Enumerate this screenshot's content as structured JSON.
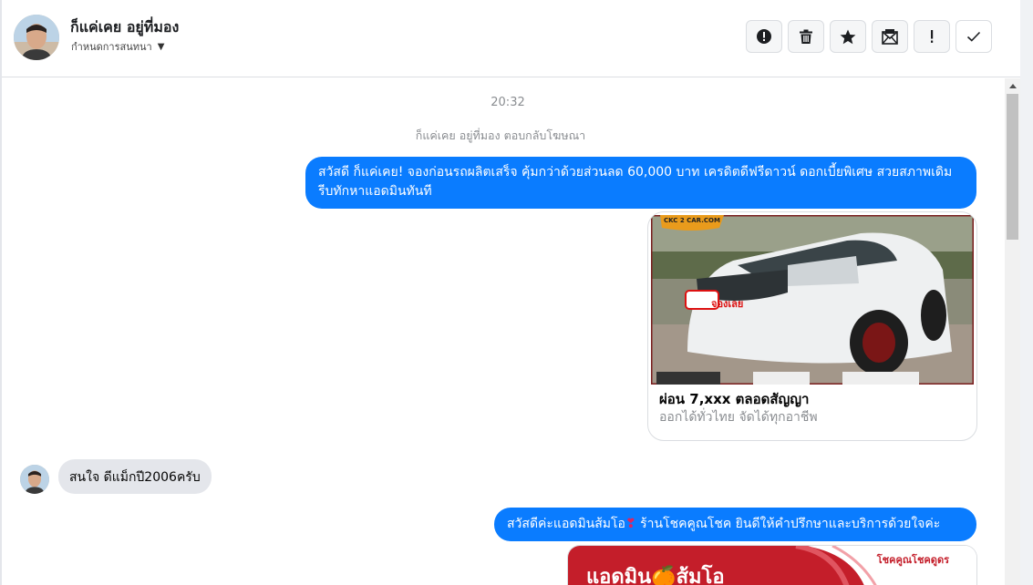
{
  "header": {
    "contact_name": "ก็แค่เคย อยู่ที่มอง",
    "convo_menu_label": "กำหนดการสนทนา",
    "toolbar": [
      {
        "name": "mark-spam-button",
        "icon": "alert-circle-icon"
      },
      {
        "name": "delete-button",
        "icon": "trash-icon"
      },
      {
        "name": "star-button",
        "icon": "star-icon"
      },
      {
        "name": "mark-unread-button",
        "icon": "envelope-icon"
      },
      {
        "name": "flag-button",
        "icon": "exclamation-icon"
      },
      {
        "name": "mark-done-button",
        "icon": "check-icon"
      }
    ]
  },
  "thread": {
    "timestamp": "20:32",
    "reply_note": "ก็แค่เคย อยู่ที่มอง ตอบกลับโฆษณา",
    "messages": [
      {
        "direction": "outgoing",
        "text": "สวัสดี ก็แค่เคย! จองก่อนรถผลิตเสร็จ คุ้มกว่าด้วยส่วนลด 60,000 บาท เครดิตดีฟรีดาวน์ ดอกเบี้ยพิเศษ สวยสภาพเดิม รีบทักหาแอดมินทันที"
      },
      {
        "direction": "outgoing",
        "type": "ad-card",
        "image_badge": "CKC 2 CAR.COM",
        "image_stamp": "จองเลย",
        "title": "ผ่อน 7,xxx ตลอดสัญญา",
        "subtitle": "ออกได้ทั่วไทย จัดได้ทุกอาชีพ"
      },
      {
        "direction": "incoming",
        "text": "สนใจ ดีแม็กปี2006ครับ"
      },
      {
        "direction": "outgoing",
        "text_before_icon": "สวัสดีค่ะแอดมินส้มโอ",
        "heart": "❣",
        "text_after_icon": " ร้านโชคคูณโชค ยินดีให้คำปรึกษาและบริการด้วยใจค่ะ"
      },
      {
        "direction": "outgoing",
        "type": "image-card",
        "banner_text": "แอดมิน🍊ส้มโอ",
        "shop_name": "โชคคูณโชคดูดร"
      }
    ]
  },
  "colors": {
    "outgoing_bubble": "#0a7cff",
    "incoming_bubble": "#e4e6eb",
    "muted_text": "#8a8d91",
    "banner_red": "#c41e2a"
  }
}
